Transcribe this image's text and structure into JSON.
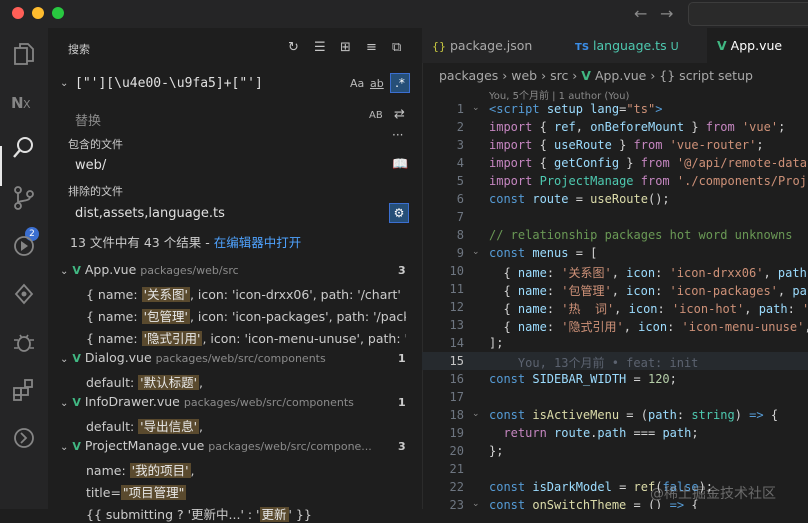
{
  "colors": {
    "close": "#ff5f57",
    "minimize": "#febc2e",
    "maximize": "#28c840",
    "accent": "#3b6fd1",
    "vue": "#41b883"
  },
  "search": {
    "title": "搜索",
    "query": "[\"'][\\u4e00-\\u9fa5]+[\"']",
    "match_case": "Aa",
    "whole_word": "ab",
    "replace_placeholder": "替换",
    "replace_all": "AB",
    "include_label": "包含的文件",
    "include_value": "web/",
    "exclude_label": "排除的文件",
    "exclude_value": "dist,assets,language.ts",
    "summary": "13 文件中有 43 个结果 - ",
    "open_in_editor": "在编辑器中打开",
    "more": "···"
  },
  "results": [
    {
      "file": "App.vue",
      "path": "packages/web/src",
      "count": "3",
      "lines": [
        {
          "pre": "{ name: ",
          "hl": "'关系图'",
          "post": ", icon: 'icon-drxx06', path: '/chart' },"
        },
        {
          "pre": "{ name: ",
          "hl": "'包管理'",
          "post": ", icon: 'icon-packages', path: '/packag..."
        },
        {
          "pre": "{ name: ",
          "hl": "'隐式引用'",
          "post": ", icon: 'icon-menu-unuse', path: '/un..."
        }
      ]
    },
    {
      "file": "Dialog.vue",
      "path": "packages/web/src/components",
      "count": "1",
      "lines": [
        {
          "pre": "default: ",
          "hl": "'默认标题'",
          "post": ","
        }
      ]
    },
    {
      "file": "InfoDrawer.vue",
      "path": "packages/web/src/components",
      "count": "1",
      "lines": [
        {
          "pre": "default: ",
          "hl": "'导出信息'",
          "post": ","
        }
      ]
    },
    {
      "file": "ProjectManage.vue",
      "path": "packages/web/src/compone...",
      "count": "3",
      "lines": [
        {
          "pre": "name: ",
          "hl": "'我的项目'",
          "post": ","
        },
        {
          "pre": "title=",
          "hl": "\"项目管理\"",
          "post": ""
        },
        {
          "pre": "{{ submitting ? '更新中...' : '",
          "hl": "更新",
          "post": "' }}"
        }
      ]
    }
  ],
  "tabs": [
    {
      "icon": "{}",
      "label": "package.json",
      "extra": ""
    },
    {
      "icon": "TS",
      "label": "language.ts",
      "extra": "U"
    },
    {
      "icon": "V",
      "label": "App.vue",
      "extra": ""
    }
  ],
  "breadcrumbs": [
    "packages",
    "web",
    "src",
    "App.vue",
    "{} script setup"
  ],
  "blame_top": "You, 5个月前 | 1 author (You)",
  "code_lines": [
    {
      "n": "1",
      "fold": "⌄"
    },
    {
      "n": "2",
      "fold": ""
    },
    {
      "n": "3",
      "fold": ""
    },
    {
      "n": "4",
      "fold": ""
    },
    {
      "n": "5",
      "fold": ""
    },
    {
      "n": "6",
      "fold": ""
    },
    {
      "n": "7",
      "fold": ""
    },
    {
      "n": "8",
      "fold": ""
    },
    {
      "n": "9",
      "fold": "⌄"
    },
    {
      "n": "10",
      "fold": ""
    },
    {
      "n": "11",
      "fold": ""
    },
    {
      "n": "12",
      "fold": ""
    },
    {
      "n": "13",
      "fold": ""
    },
    {
      "n": "14",
      "fold": ""
    },
    {
      "n": "15",
      "fold": ""
    },
    {
      "n": "16",
      "fold": ""
    },
    {
      "n": "17",
      "fold": ""
    },
    {
      "n": "18",
      "fold": "⌄"
    },
    {
      "n": "19",
      "fold": ""
    },
    {
      "n": "20",
      "fold": ""
    },
    {
      "n": "21",
      "fold": ""
    },
    {
      "n": "22",
      "fold": ""
    },
    {
      "n": "23",
      "fold": "⌄"
    }
  ],
  "inline_blame": "You, 13个月前 • feat: init",
  "watermark": "@稀土掘金技术社区"
}
